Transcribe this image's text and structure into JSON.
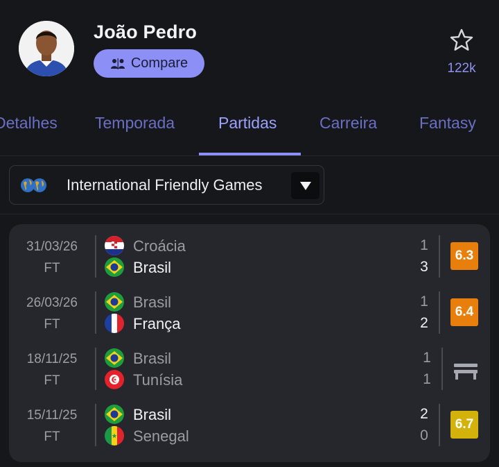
{
  "player": {
    "name": "João Pedro",
    "compare_label": "Compare",
    "followers": "122k"
  },
  "tabs": [
    {
      "label": "Detalhes",
      "active": false
    },
    {
      "label": "Temporada",
      "active": false
    },
    {
      "label": "Partidas",
      "active": true
    },
    {
      "label": "Carreira",
      "active": false
    },
    {
      "label": "Fantasy",
      "active": false
    }
  ],
  "competition": {
    "name": "International Friendly Games"
  },
  "matches": [
    {
      "date": "31/03/26",
      "status": "FT",
      "home": {
        "name": "Croácia",
        "flag": "croatia-flag",
        "score": "1",
        "winner": false
      },
      "away": {
        "name": "Brasil",
        "flag": "brazil-flag",
        "score": "3",
        "winner": true
      },
      "rating": "6.3",
      "rating_color": "#e87f0c"
    },
    {
      "date": "26/03/26",
      "status": "FT",
      "home": {
        "name": "Brasil",
        "flag": "brazil-flag",
        "score": "1",
        "winner": false
      },
      "away": {
        "name": "França",
        "flag": "france-flag",
        "score": "2",
        "winner": true
      },
      "rating": "6.4",
      "rating_color": "#e87f0c"
    },
    {
      "date": "18/11/25",
      "status": "FT",
      "home": {
        "name": "Brasil",
        "flag": "brazil-flag",
        "score": "1",
        "winner": false
      },
      "away": {
        "name": "Tunísia",
        "flag": "tunisia-flag",
        "score": "1",
        "winner": false
      },
      "rating": "",
      "rating_icon": "bench-icon"
    },
    {
      "date": "15/11/25",
      "status": "FT",
      "home": {
        "name": "Brasil",
        "flag": "brazil-flag",
        "score": "2",
        "winner": true
      },
      "away": {
        "name": "Senegal",
        "flag": "senegal-flag",
        "score": "0",
        "winner": false
      },
      "rating": "6.7",
      "rating_color": "#d4b20c"
    }
  ],
  "colors": {
    "accent": "#8c90f6",
    "background": "#16171b",
    "card": "#25272c"
  }
}
